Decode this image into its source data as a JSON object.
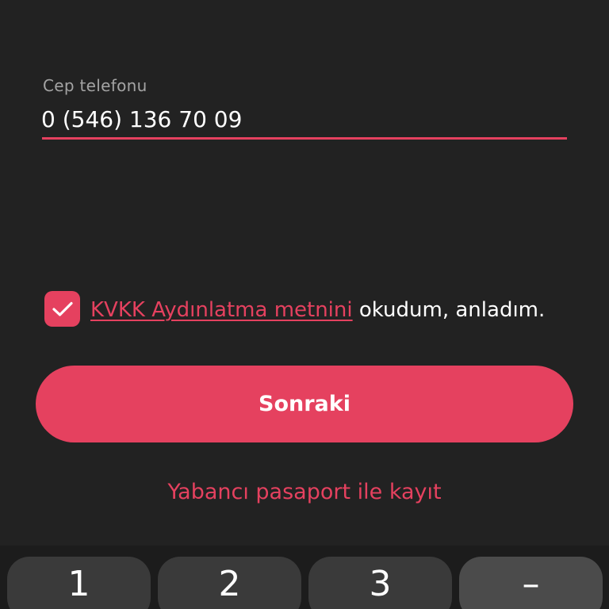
{
  "phone_field": {
    "label": "Cep telefonu",
    "value": "0 (546) 136 70 09"
  },
  "consent": {
    "checked": true,
    "link_text": "KVKK Aydınlatma metnini",
    "rest_text": " okudum, anladım."
  },
  "buttons": {
    "next_label": "Sonraki",
    "foreign_passport_label": "Yabancı pasaport ile kayıt"
  },
  "keyboard": {
    "keys": [
      "1",
      "2",
      "3",
      "–"
    ]
  },
  "colors": {
    "accent": "#e5415f",
    "background": "#222222",
    "label": "#a4a4a4",
    "key": "#3a3a3a"
  }
}
